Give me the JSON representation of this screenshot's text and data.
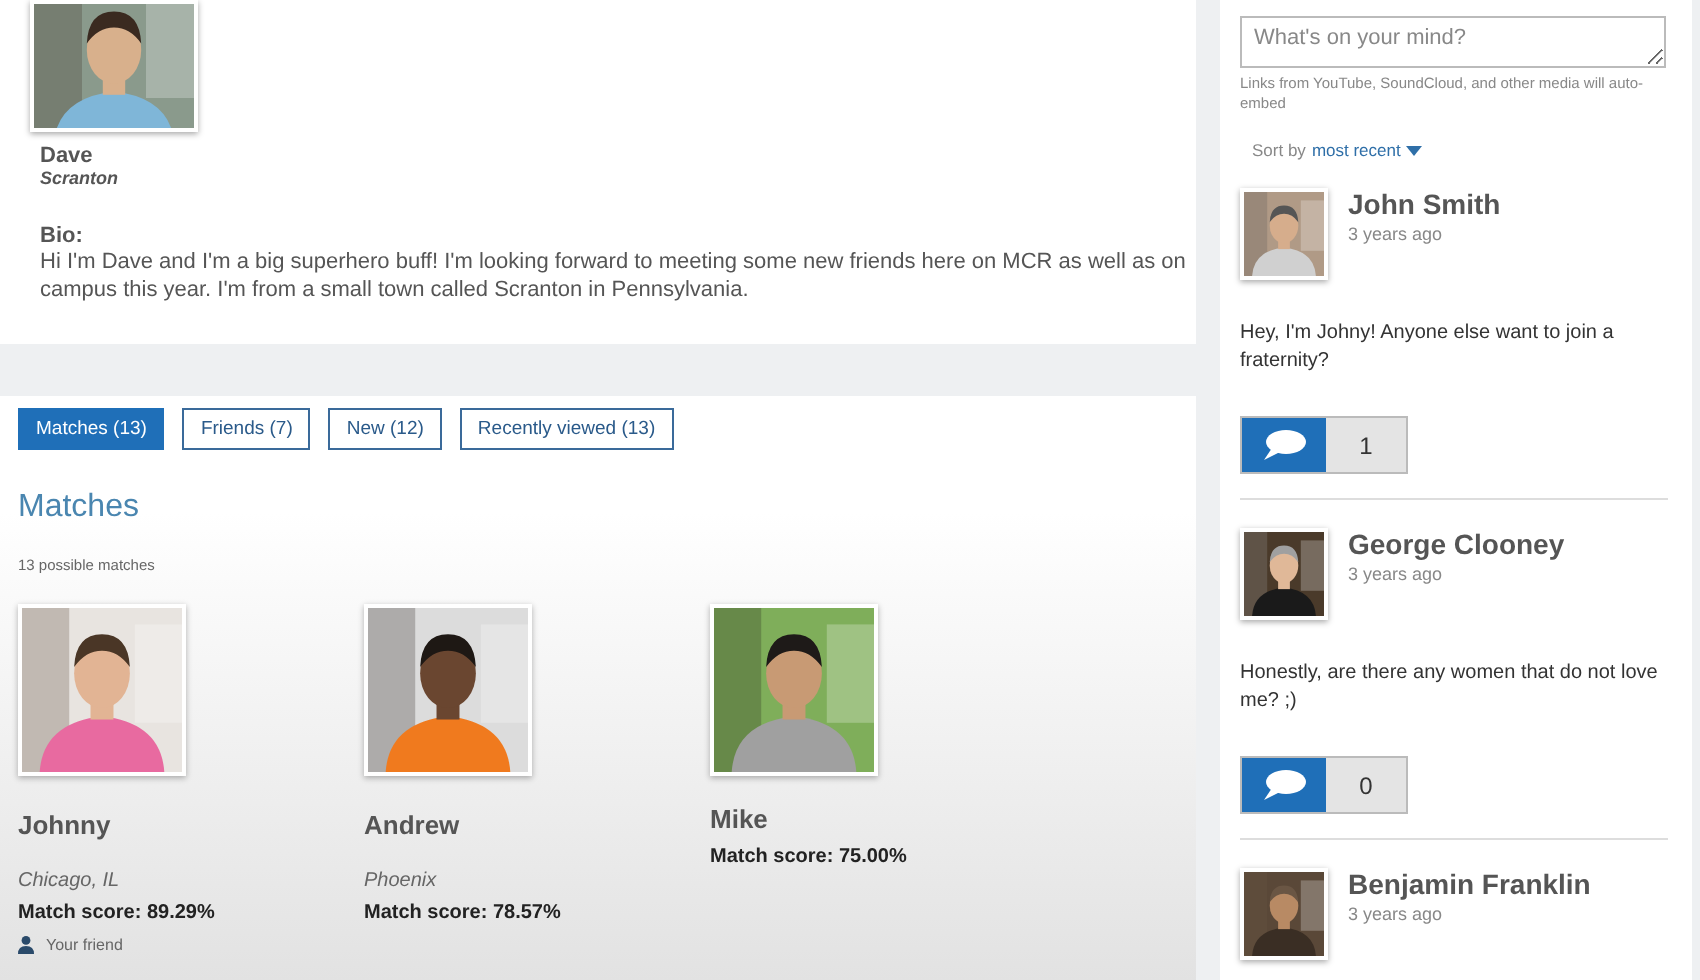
{
  "profile": {
    "name": "Dave",
    "location": "Scranton",
    "bio_label": "Bio:",
    "bio": "Hi I'm Dave and I'm a big superhero buff! I'm looking forward to meeting some new friends here on MCR as well as on campus this year. I'm from a small town called Scranton in Pennsylvania."
  },
  "tabs": [
    {
      "label": "Matches (13)",
      "selected": true
    },
    {
      "label": "Friends (7)",
      "selected": false
    },
    {
      "label": "New (12)",
      "selected": false
    },
    {
      "label": "Recently viewed (13)",
      "selected": false
    }
  ],
  "matches": {
    "title": "Matches",
    "count_text": "13 possible matches",
    "people": [
      {
        "name": "Johnny",
        "location": "Chicago, IL",
        "score": "Match score: 89.29%",
        "friend_label": "Your friend"
      },
      {
        "name": "Andrew",
        "location": "Phoenix",
        "score": "Match score: 78.57%"
      },
      {
        "name": "Mike",
        "score": "Match score: 75.00%"
      }
    ]
  },
  "feed": {
    "post_placeholder": "What's on your mind?",
    "hint": "Links from YouTube, SoundCloud, and other media will auto-embed",
    "sort_label": "Sort by",
    "sort_value": "most recent",
    "posts": [
      {
        "author": "John Smith",
        "time": "3 years ago",
        "text": "Hey, I'm Johny! Anyone else want to join a fraternity?",
        "comments": "1"
      },
      {
        "author": "George Clooney",
        "time": "3 years ago",
        "text": "Honestly, are there any women that do not love me? ;)",
        "comments": "0"
      },
      {
        "author": "Benjamin Franklin",
        "time": "3 years ago"
      }
    ]
  }
}
